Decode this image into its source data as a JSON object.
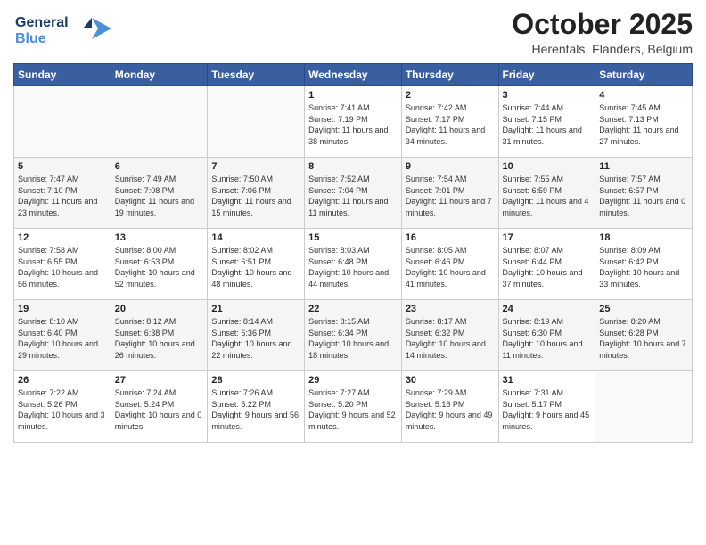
{
  "logo": {
    "line1": "General",
    "line2": "Blue"
  },
  "title": "October 2025",
  "location": "Herentals, Flanders, Belgium",
  "days_of_week": [
    "Sunday",
    "Monday",
    "Tuesday",
    "Wednesday",
    "Thursday",
    "Friday",
    "Saturday"
  ],
  "weeks": [
    [
      {
        "num": "",
        "sunrise": "",
        "sunset": "",
        "daylight": ""
      },
      {
        "num": "",
        "sunrise": "",
        "sunset": "",
        "daylight": ""
      },
      {
        "num": "",
        "sunrise": "",
        "sunset": "",
        "daylight": ""
      },
      {
        "num": "1",
        "sunrise": "7:41 AM",
        "sunset": "7:19 PM",
        "daylight": "11 hours and 38 minutes."
      },
      {
        "num": "2",
        "sunrise": "7:42 AM",
        "sunset": "7:17 PM",
        "daylight": "11 hours and 34 minutes."
      },
      {
        "num": "3",
        "sunrise": "7:44 AM",
        "sunset": "7:15 PM",
        "daylight": "11 hours and 31 minutes."
      },
      {
        "num": "4",
        "sunrise": "7:45 AM",
        "sunset": "7:13 PM",
        "daylight": "11 hours and 27 minutes."
      }
    ],
    [
      {
        "num": "5",
        "sunrise": "7:47 AM",
        "sunset": "7:10 PM",
        "daylight": "11 hours and 23 minutes."
      },
      {
        "num": "6",
        "sunrise": "7:49 AM",
        "sunset": "7:08 PM",
        "daylight": "11 hours and 19 minutes."
      },
      {
        "num": "7",
        "sunrise": "7:50 AM",
        "sunset": "7:06 PM",
        "daylight": "11 hours and 15 minutes."
      },
      {
        "num": "8",
        "sunrise": "7:52 AM",
        "sunset": "7:04 PM",
        "daylight": "11 hours and 11 minutes."
      },
      {
        "num": "9",
        "sunrise": "7:54 AM",
        "sunset": "7:01 PM",
        "daylight": "11 hours and 7 minutes."
      },
      {
        "num": "10",
        "sunrise": "7:55 AM",
        "sunset": "6:59 PM",
        "daylight": "11 hours and 4 minutes."
      },
      {
        "num": "11",
        "sunrise": "7:57 AM",
        "sunset": "6:57 PM",
        "daylight": "11 hours and 0 minutes."
      }
    ],
    [
      {
        "num": "12",
        "sunrise": "7:58 AM",
        "sunset": "6:55 PM",
        "daylight": "10 hours and 56 minutes."
      },
      {
        "num": "13",
        "sunrise": "8:00 AM",
        "sunset": "6:53 PM",
        "daylight": "10 hours and 52 minutes."
      },
      {
        "num": "14",
        "sunrise": "8:02 AM",
        "sunset": "6:51 PM",
        "daylight": "10 hours and 48 minutes."
      },
      {
        "num": "15",
        "sunrise": "8:03 AM",
        "sunset": "6:48 PM",
        "daylight": "10 hours and 44 minutes."
      },
      {
        "num": "16",
        "sunrise": "8:05 AM",
        "sunset": "6:46 PM",
        "daylight": "10 hours and 41 minutes."
      },
      {
        "num": "17",
        "sunrise": "8:07 AM",
        "sunset": "6:44 PM",
        "daylight": "10 hours and 37 minutes."
      },
      {
        "num": "18",
        "sunrise": "8:09 AM",
        "sunset": "6:42 PM",
        "daylight": "10 hours and 33 minutes."
      }
    ],
    [
      {
        "num": "19",
        "sunrise": "8:10 AM",
        "sunset": "6:40 PM",
        "daylight": "10 hours and 29 minutes."
      },
      {
        "num": "20",
        "sunrise": "8:12 AM",
        "sunset": "6:38 PM",
        "daylight": "10 hours and 26 minutes."
      },
      {
        "num": "21",
        "sunrise": "8:14 AM",
        "sunset": "6:36 PM",
        "daylight": "10 hours and 22 minutes."
      },
      {
        "num": "22",
        "sunrise": "8:15 AM",
        "sunset": "6:34 PM",
        "daylight": "10 hours and 18 minutes."
      },
      {
        "num": "23",
        "sunrise": "8:17 AM",
        "sunset": "6:32 PM",
        "daylight": "10 hours and 14 minutes."
      },
      {
        "num": "24",
        "sunrise": "8:19 AM",
        "sunset": "6:30 PM",
        "daylight": "10 hours and 11 minutes."
      },
      {
        "num": "25",
        "sunrise": "8:20 AM",
        "sunset": "6:28 PM",
        "daylight": "10 hours and 7 minutes."
      }
    ],
    [
      {
        "num": "26",
        "sunrise": "7:22 AM",
        "sunset": "5:26 PM",
        "daylight": "10 hours and 3 minutes."
      },
      {
        "num": "27",
        "sunrise": "7:24 AM",
        "sunset": "5:24 PM",
        "daylight": "10 hours and 0 minutes."
      },
      {
        "num": "28",
        "sunrise": "7:26 AM",
        "sunset": "5:22 PM",
        "daylight": "9 hours and 56 minutes."
      },
      {
        "num": "29",
        "sunrise": "7:27 AM",
        "sunset": "5:20 PM",
        "daylight": "9 hours and 52 minutes."
      },
      {
        "num": "30",
        "sunrise": "7:29 AM",
        "sunset": "5:18 PM",
        "daylight": "9 hours and 49 minutes."
      },
      {
        "num": "31",
        "sunrise": "7:31 AM",
        "sunset": "5:17 PM",
        "daylight": "9 hours and 45 minutes."
      },
      {
        "num": "",
        "sunrise": "",
        "sunset": "",
        "daylight": ""
      }
    ]
  ]
}
